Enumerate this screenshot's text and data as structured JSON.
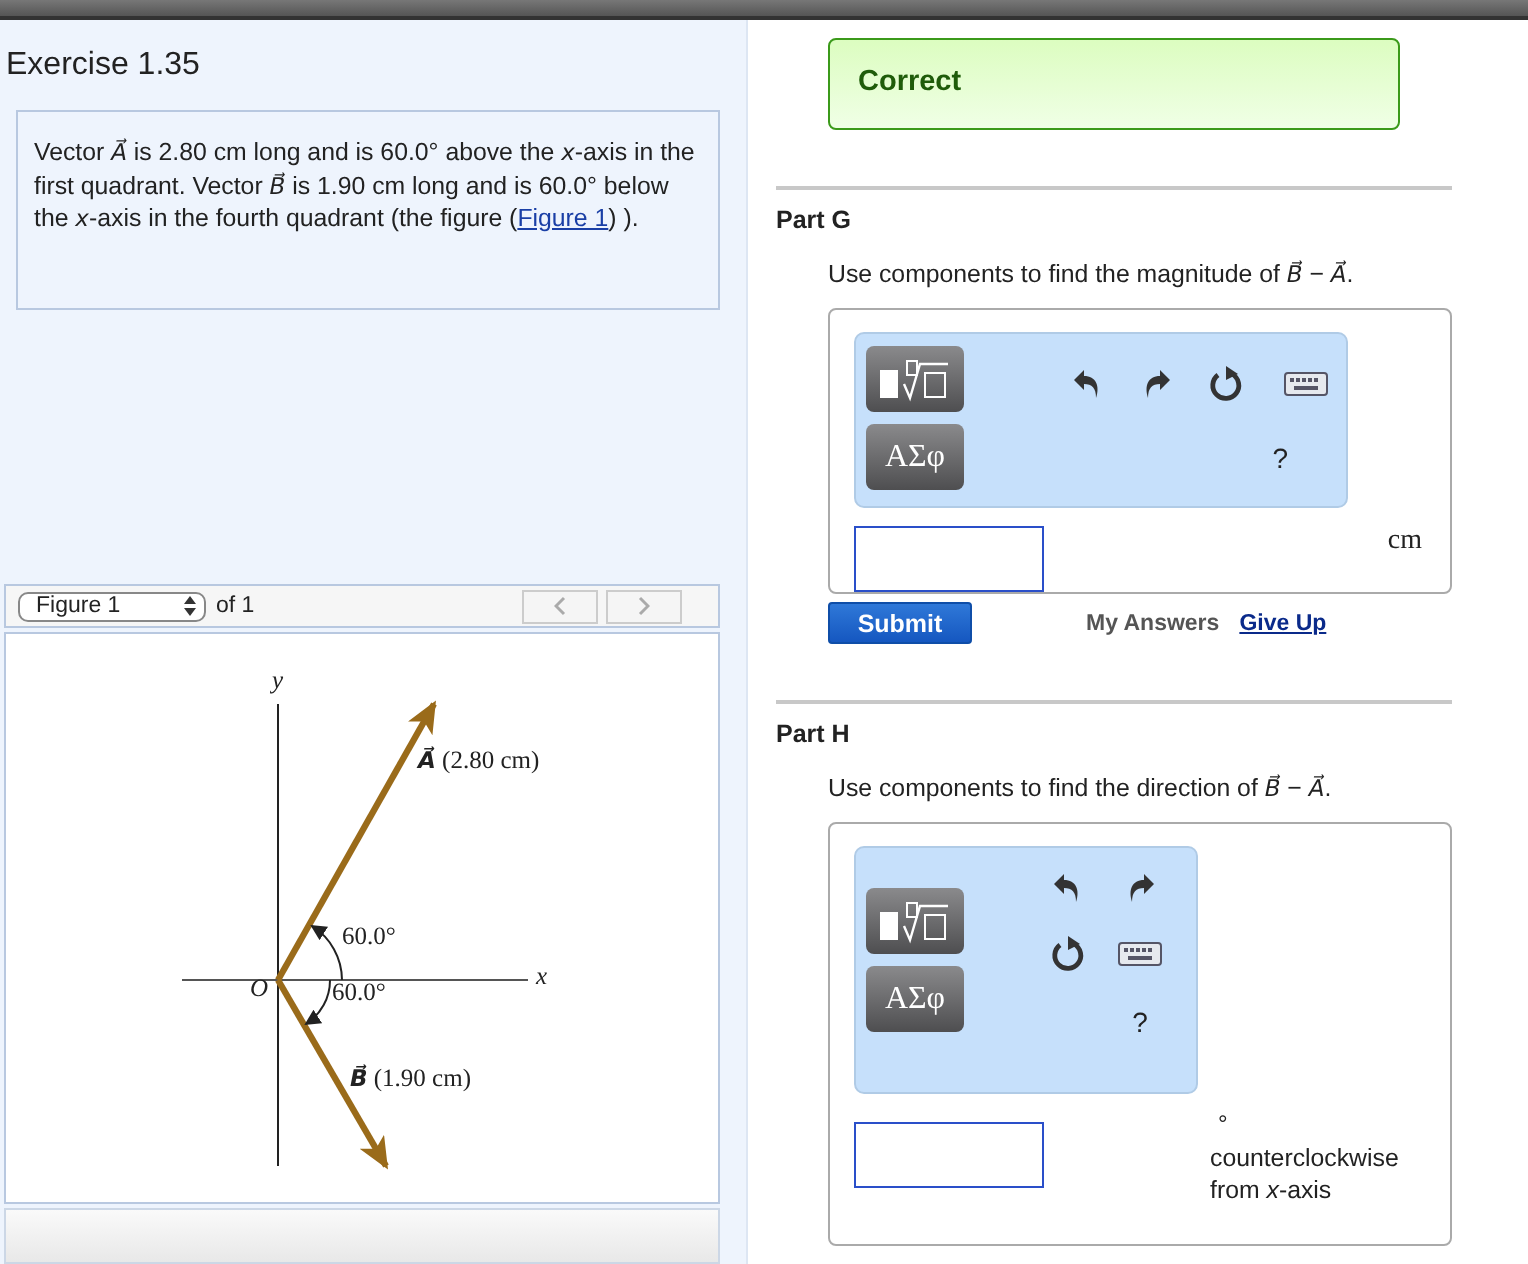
{
  "exercise": {
    "title": "Exercise 1.35",
    "problem_before": "Vector *A⃗* is 2.80 cm long and is 60.0° above the *x*-axis in the first quadrant. Vector *B⃗* is 1.90 cm long and is 60.0° below the *x*-axis in the fourth quadrant (the figure (",
    "figure_link": "Figure 1",
    "problem_after": ") )."
  },
  "figure_nav": {
    "select": "Figure 1",
    "count": "of 1"
  },
  "figure": {
    "y_label": "y",
    "x_label": "x",
    "origin_label": "O",
    "vector_a": {
      "symbol": "A⃗",
      "text": "(2.80 cm)"
    },
    "vector_b": {
      "symbol": "B⃗",
      "text": "(1.90 cm)"
    },
    "angle_a": "60.0°",
    "angle_b": "60.0°"
  },
  "feedback": {
    "text": "Correct"
  },
  "parts": [
    {
      "title": "Part G",
      "prompt": "Use components to find the magnitude of *B⃗* − *A⃗*.",
      "kind": "wide",
      "symbols": "ΑΣφ",
      "help": "?",
      "unit": "cm",
      "submit": "Submit",
      "my_answers": "My Answers",
      "give_up": "Give Up"
    },
    {
      "title": "Part H",
      "prompt": "Use components to find the direction of *B⃗* − *A⃗*.",
      "kind": "compact",
      "symbols": "ΑΣφ",
      "help": "?",
      "unit": "°",
      "unit_note": "counterclockwise from *x*-axis"
    }
  ]
}
